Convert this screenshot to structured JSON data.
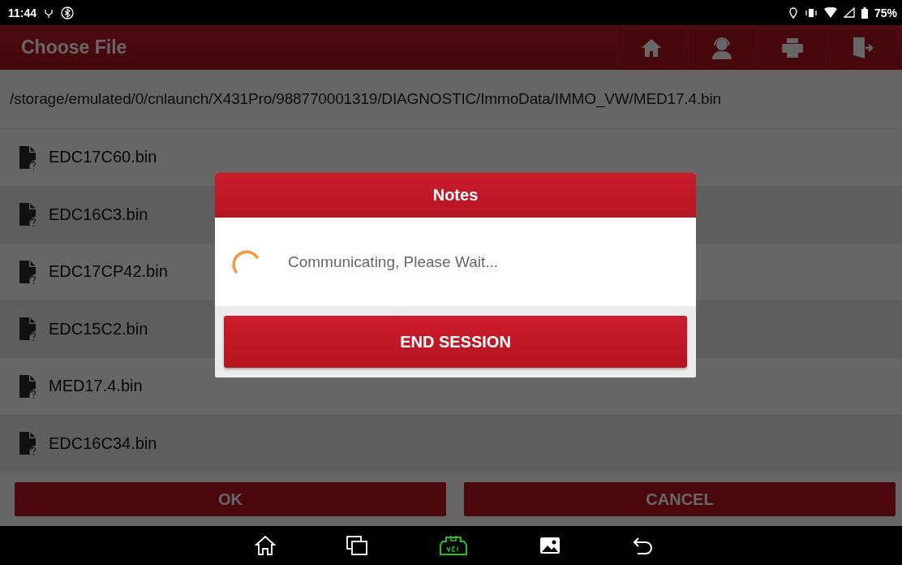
{
  "status_bar": {
    "time": "11:44",
    "battery": "75%"
  },
  "header": {
    "title": "Choose File"
  },
  "path": "/storage/emulated/0/cnlaunch/X431Pro/988770001319/DIAGNOSTIC/ImmoData/IMMO_VW/MED17.4.bin",
  "files": [
    {
      "name": "EDC17C60.bin"
    },
    {
      "name": "EDC16C3.bin"
    },
    {
      "name": "EDC17CP42.bin"
    },
    {
      "name": "EDC15C2.bin"
    },
    {
      "name": "MED17.4.bin"
    },
    {
      "name": "EDC16C34.bin"
    }
  ],
  "buttons": [
    "OK",
    "CANCEL"
  ],
  "dialog": {
    "title": "Notes",
    "message": "Communicating, Please Wait...",
    "button": "END SESSION"
  }
}
